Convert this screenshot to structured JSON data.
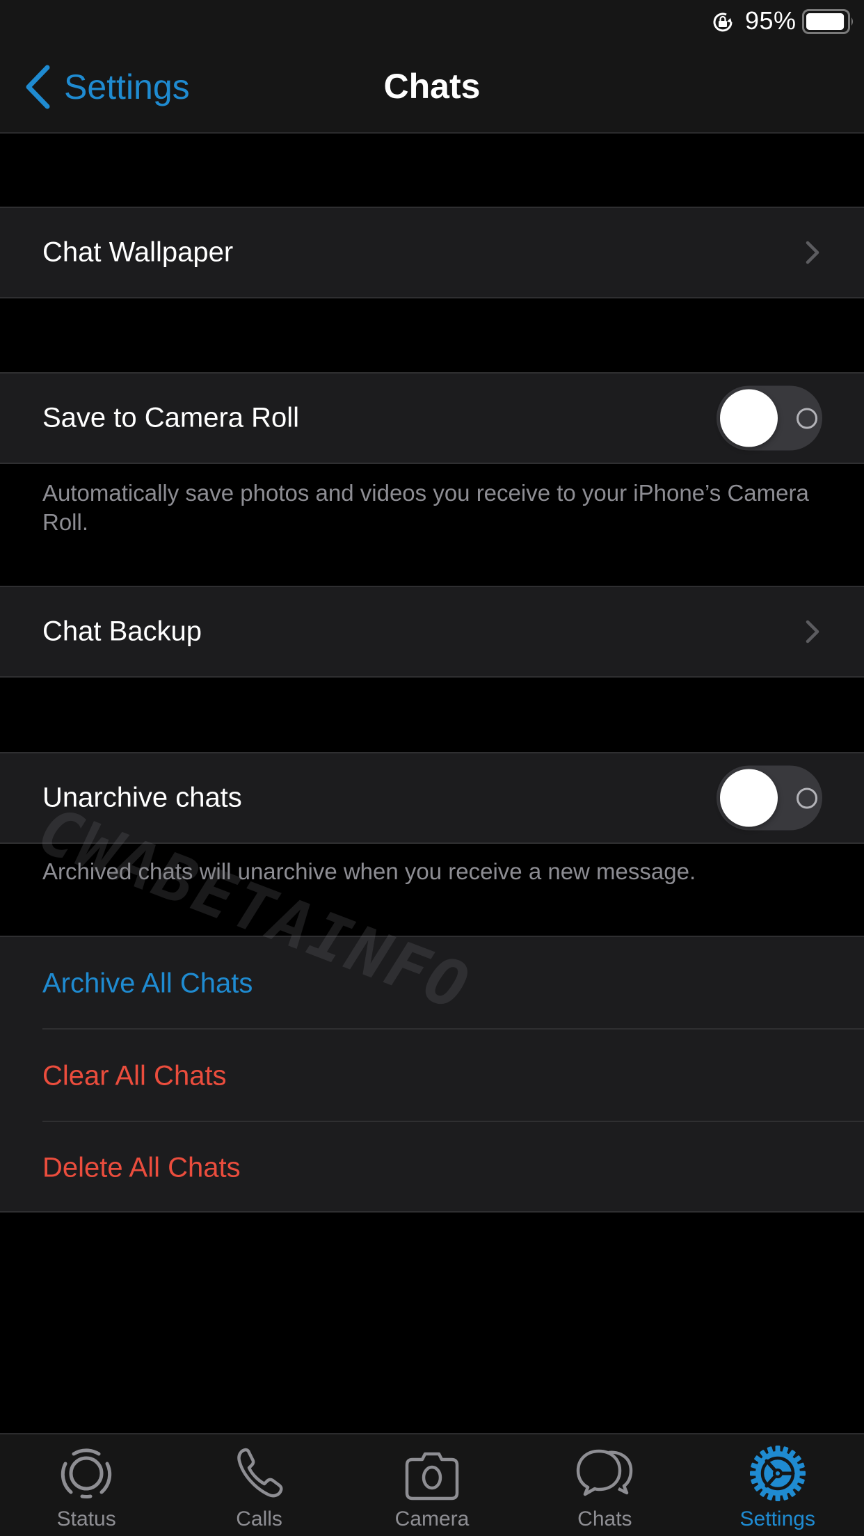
{
  "status_bar": {
    "battery_percent_label": "95%",
    "battery_level": 0.95,
    "orientation_lock_icon": "orientation-lock-icon"
  },
  "nav": {
    "back_label": "Settings",
    "back_icon": "chevron-left-icon",
    "title": "Chats"
  },
  "sections": {
    "wallpaper": {
      "label": "Chat Wallpaper",
      "accessory": "chevron-right-icon"
    },
    "save_camera_roll": {
      "label": "Save to Camera Roll",
      "toggle_on": false,
      "footer": "Automatically save photos and videos you receive to your iPhone’s Camera Roll."
    },
    "backup": {
      "label": "Chat Backup",
      "accessory": "chevron-right-icon"
    },
    "unarchive": {
      "label": "Unarchive chats",
      "toggle_on": false,
      "footer": "Archived chats will unarchive when you receive a new message."
    },
    "actions": [
      {
        "label": "Archive All Chats",
        "color": "#1f8bd1"
      },
      {
        "label": "Clear All Chats",
        "color": "#eb4d3d"
      },
      {
        "label": "Delete All Chats",
        "color": "#eb4d3d"
      }
    ]
  },
  "watermark": "CWABETAINFO",
  "tab_bar": {
    "active_index": 4,
    "tabs": [
      {
        "label": "Status",
        "icon": "status-icon"
      },
      {
        "label": "Calls",
        "icon": "phone-icon"
      },
      {
        "label": "Camera",
        "icon": "camera-icon"
      },
      {
        "label": "Chats",
        "icon": "chat-bubbles-icon"
      },
      {
        "label": "Settings",
        "icon": "gear-icon"
      }
    ]
  },
  "colors": {
    "accent": "#1f8bd1",
    "destructive": "#eb4d3d",
    "cell_background": "#1c1c1e",
    "grouped_background": "#000000",
    "bar_background": "#161616",
    "secondary_text": "#8d8d93",
    "tab_inactive": "#8e8e93"
  }
}
